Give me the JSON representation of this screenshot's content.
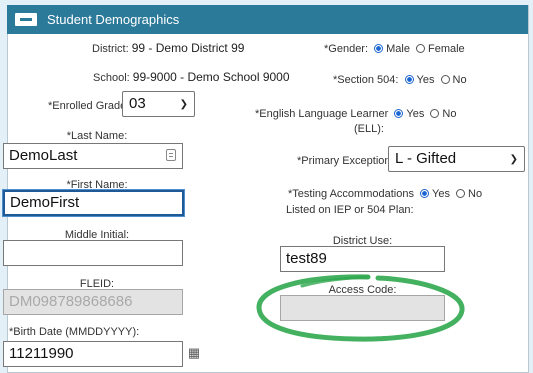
{
  "section": {
    "title": "Student Demographics"
  },
  "district": {
    "label": "District:",
    "value": "99 - Demo District 99"
  },
  "school": {
    "label": "School:",
    "value": "99-9000 - Demo School 9000"
  },
  "enrolled_grade": {
    "label": "*Enrolled Grade:",
    "value": "03"
  },
  "last_name": {
    "label": "*Last Name:",
    "value": "DemoLast"
  },
  "first_name": {
    "label": "*First Name:",
    "value": "DemoFirst"
  },
  "middle_initial": {
    "label": "Middle Initial:",
    "value": ""
  },
  "fleid": {
    "label": "FLEID:",
    "value": "DM098789868686"
  },
  "birth_date": {
    "label": "*Birth Date (MMDDYYYY):",
    "value": "11211990"
  },
  "gender": {
    "label": "*Gender:",
    "options": [
      "Male",
      "Female"
    ],
    "selected": "Male"
  },
  "section_504": {
    "label": "*Section 504:",
    "options": [
      "Yes",
      "No"
    ],
    "selected": "Yes"
  },
  "ell": {
    "label_line1": "*English Language Learner",
    "label_line2": "(ELL):",
    "options": [
      "Yes",
      "No"
    ],
    "selected": "Yes"
  },
  "primary_exceptionality": {
    "label": "*Primary Exceptionality:",
    "value": "L - Gifted"
  },
  "testing_accommodations": {
    "label_line1": "*Testing Accommodations",
    "label_line2": "Listed on IEP or 504 Plan:",
    "options": [
      "Yes",
      "No"
    ],
    "selected": "Yes"
  },
  "district_use": {
    "label": "District Use:",
    "value": "test89"
  },
  "access_code": {
    "label": "Access Code:",
    "value": ""
  },
  "colors": {
    "header": "#2c7a9a",
    "highlight": "#2fa84f",
    "focus": "#1f5a96",
    "radio": "#1a66d2"
  }
}
